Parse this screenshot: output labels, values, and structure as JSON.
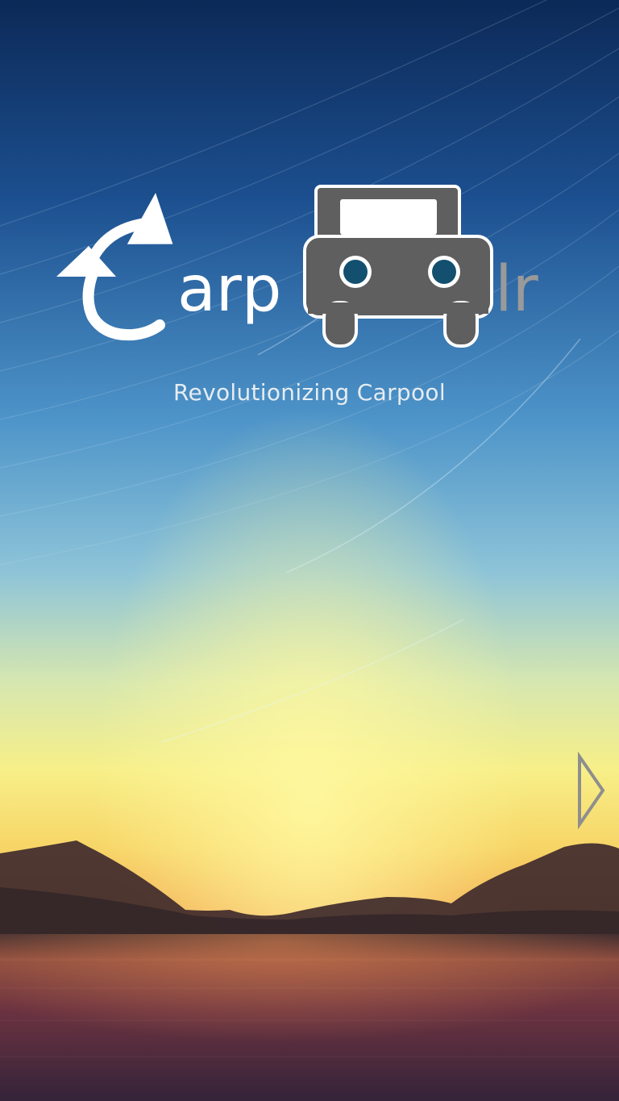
{
  "app": {
    "logo": {
      "text_left": "arp",
      "text_right": "lr",
      "icon_arrows": "refresh-arrows-icon",
      "icon_car": "car-icon"
    },
    "tagline": "Revolutionizing Carpool"
  },
  "navigation": {
    "next_icon": "chevron-right-icon"
  },
  "colors": {
    "sky_top": "#0d2d5e",
    "sky_mid": "#3f86c1",
    "horizon": "#f6ee84",
    "sunset": "#f0a44a",
    "water": "#6a2e3c",
    "car_body": "#5f5f5f",
    "car_lights": "#13506f",
    "logo_white": "#ffffff",
    "logo_grey": "#9a9a9a"
  }
}
